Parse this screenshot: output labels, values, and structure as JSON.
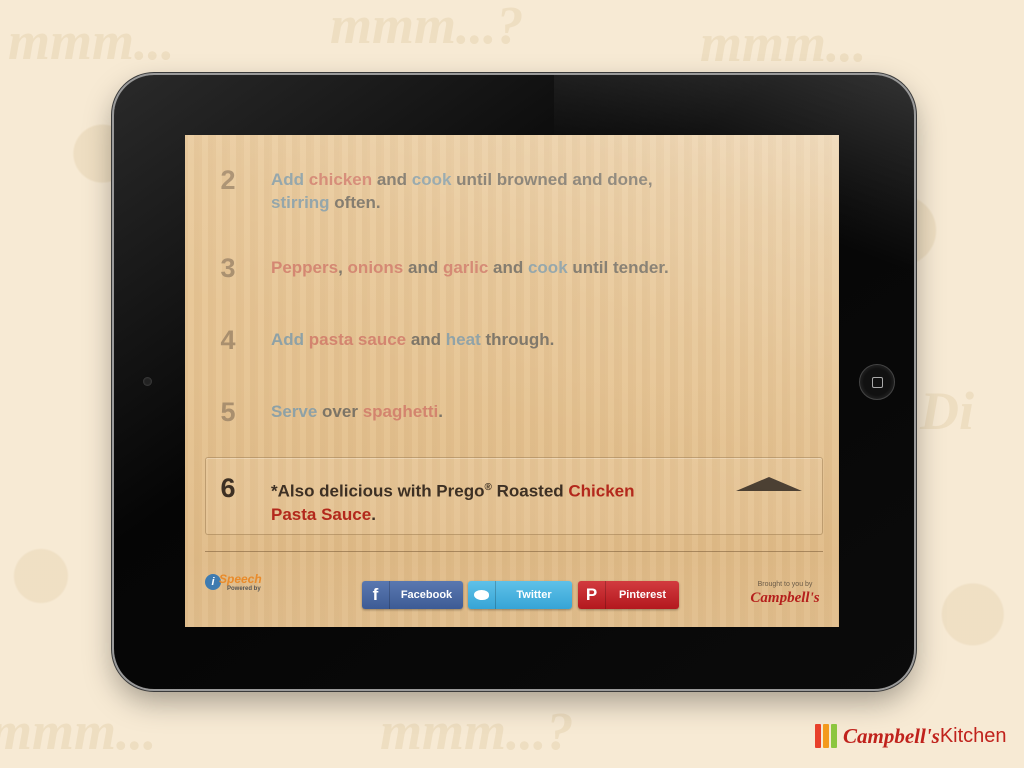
{
  "steps": [
    {
      "number": "2",
      "segments": [
        {
          "text": "Add ",
          "tone": "blue"
        },
        {
          "text": "chicken",
          "tone": "red"
        },
        {
          "text": " and ",
          "tone": "dark"
        },
        {
          "text": "cook",
          "tone": "blue"
        },
        {
          "text": " until browned and done, ",
          "tone": "dark"
        },
        {
          "text": "stirring",
          "tone": "blue"
        },
        {
          "text": " often.",
          "tone": "dark"
        }
      ]
    },
    {
      "number": "3",
      "segments": [
        {
          "text": "Peppers",
          "tone": "red"
        },
        {
          "text": ", ",
          "tone": "dark"
        },
        {
          "text": "onions",
          "tone": "red"
        },
        {
          "text": " and ",
          "tone": "dark"
        },
        {
          "text": "garlic",
          "tone": "red"
        },
        {
          "text": " and ",
          "tone": "dark"
        },
        {
          "text": "cook",
          "tone": "blue"
        },
        {
          "text": " until tender.",
          "tone": "dark"
        }
      ]
    },
    {
      "number": "4",
      "segments": [
        {
          "text": "Add ",
          "tone": "blue"
        },
        {
          "text": "pasta sauce",
          "tone": "red"
        },
        {
          "text": " and ",
          "tone": "dark"
        },
        {
          "text": "heat",
          "tone": "blue"
        },
        {
          "text": " through.",
          "tone": "dark"
        }
      ]
    },
    {
      "number": "5",
      "segments": [
        {
          "text": "Serve",
          "tone": "blue"
        },
        {
          "text": " over ",
          "tone": "dark"
        },
        {
          "text": "spaghetti",
          "tone": "red"
        },
        {
          "text": ".",
          "tone": "dark"
        }
      ]
    }
  ],
  "active_step": {
    "number": "6",
    "part1": "*Also delicious with Prego",
    "reg": "®",
    "part2": " Roasted ",
    "highlight1": "Chicken",
    "highlight2": "Pasta Sauce",
    "part3": "."
  },
  "footer": {
    "ispeech_name": "Speech",
    "ispeech_icon": "i",
    "ispeech_powered": "Powered by",
    "facebook_label": "Facebook",
    "facebook_icon": "f",
    "twitter_label": "Twitter",
    "pinterest_label": "Pinterest",
    "pinterest_icon": "P",
    "brought_text": "Brought to you by",
    "brand": "Campbell's"
  },
  "logo": {
    "brand": "Campbell's",
    "suffix": "Kitchen"
  },
  "colors": {
    "background": "#f7ead4",
    "wood": "#e6c493",
    "facebook": "#3d5b95",
    "twitter": "#36a4d6",
    "pinterest": "#b3181e",
    "brand_red": "#c0221c"
  }
}
